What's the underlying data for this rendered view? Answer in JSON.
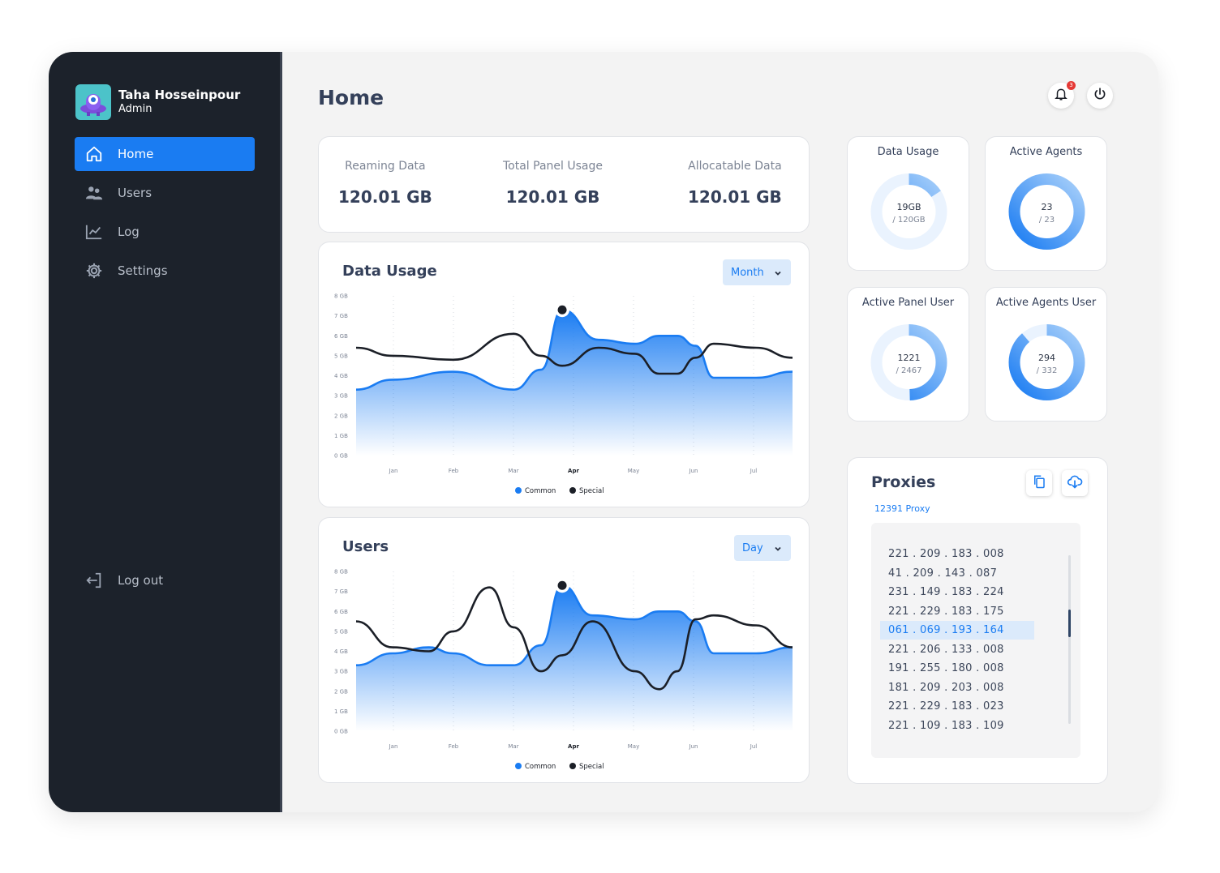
{
  "user": {
    "name": "Taha Hosseinpour",
    "role": "Admin"
  },
  "nav": {
    "items": [
      {
        "label": "Home",
        "icon": "home-icon",
        "active": true
      },
      {
        "label": "Users",
        "icon": "users-icon",
        "active": false
      },
      {
        "label": "Log",
        "icon": "chart-line-icon",
        "active": false
      },
      {
        "label": "Settings",
        "icon": "gear-icon",
        "active": false
      }
    ],
    "logout": {
      "label": "Log out",
      "icon": "logout-icon"
    }
  },
  "header": {
    "title": "Home",
    "notification_count": "3"
  },
  "stats": [
    {
      "label": "Reaming Data",
      "value": "120.01 GB"
    },
    {
      "label": "Total Panel Usage",
      "value": "120.01 GB"
    },
    {
      "label": "Allocatable Data",
      "value": "120.01 GB"
    }
  ],
  "rings": [
    {
      "title": "Data Usage",
      "line1": "19GB",
      "line2": "/ 120GB",
      "fraction": 0.158
    },
    {
      "title": "Active Agents",
      "line1": "23",
      "line2": "/ 23",
      "fraction": 1.0
    },
    {
      "title": "Active Panel User",
      "line1": "1221",
      "line2": "/ 2467",
      "fraction": 0.495
    },
    {
      "title": "Active Agents User",
      "line1": "294",
      "line2": "/ 332",
      "fraction": 0.886
    }
  ],
  "colors": {
    "accent": "#1a7cf2",
    "special": "#1b1f27",
    "sidebar": "#1c222b"
  },
  "chart_data": [
    {
      "type": "area",
      "title": "Data Usage",
      "filter": "Month",
      "categories": [
        "Jan",
        "Feb",
        "Mar",
        "Apr",
        "May",
        "Jun",
        "Jul"
      ],
      "highlight_category": "Apr",
      "y_ticks": [
        "0 GB",
        "1 GB",
        "2 GB",
        "3 GB",
        "4 GB",
        "5 GB",
        "6 GB",
        "7 GB",
        "8 GB"
      ],
      "ylim": [
        0,
        8
      ],
      "x": [
        -0.6,
        0.0,
        1.0,
        2.0,
        2.45,
        2.8,
        3.4,
        4.0,
        4.4,
        4.7,
        5.0,
        5.3,
        6.0,
        6.6
      ],
      "series": [
        {
          "name": "Common",
          "values": [
            3.3,
            3.8,
            4.2,
            3.3,
            4.3,
            7.3,
            5.8,
            5.6,
            6.0,
            6.0,
            5.5,
            3.9,
            3.9,
            4.2
          ]
        },
        {
          "name": "Special",
          "values": [
            5.4,
            5.0,
            4.8,
            6.1,
            5.0,
            4.5,
            5.4,
            5.1,
            4.1,
            4.1,
            4.9,
            5.6,
            5.4,
            4.9
          ]
        }
      ],
      "marker": {
        "x": 2.8,
        "y": 7.3
      },
      "legend": "bottom-center",
      "grid": true
    },
    {
      "type": "area",
      "title": "Users",
      "filter": "Day",
      "categories": [
        "Jan",
        "Feb",
        "Mar",
        "Apr",
        "May",
        "Jun",
        "Jul"
      ],
      "highlight_category": "Apr",
      "y_ticks": [
        "0 GB",
        "1 GB",
        "2 GB",
        "3 GB",
        "4 GB",
        "5 GB",
        "6 GB",
        "7 GB",
        "8 GB"
      ],
      "ylim": [
        0,
        8
      ],
      "x": [
        -0.6,
        0.0,
        0.6,
        1.0,
        1.6,
        2.0,
        2.45,
        2.8,
        3.3,
        4.0,
        4.4,
        4.7,
        5.0,
        5.3,
        6.0,
        6.6
      ],
      "series": [
        {
          "name": "Common",
          "values": [
            3.3,
            3.9,
            4.2,
            3.9,
            3.3,
            3.3,
            4.3,
            7.3,
            5.8,
            5.6,
            6.0,
            6.0,
            5.5,
            3.9,
            3.9,
            4.2
          ]
        },
        {
          "name": "Special",
          "values": [
            5.5,
            4.2,
            4.0,
            5.0,
            7.2,
            5.2,
            3.0,
            3.8,
            5.5,
            3.0,
            2.1,
            3.0,
            5.6,
            5.8,
            5.3,
            4.2
          ]
        }
      ],
      "marker": {
        "x": 2.8,
        "y": 7.3
      },
      "legend": "bottom-center",
      "grid": true
    }
  ],
  "proxies": {
    "title": "Proxies",
    "count_label": "12391 Proxy",
    "selected_index": 4,
    "items": [
      "221 . 209 . 183 . 008",
      "41 . 209 . 143 . 087",
      "231 . 149 . 183 . 224",
      "221 . 229 . 183 . 175",
      "061 . 069 . 193 . 164",
      "221 . 206 . 133 . 008",
      "191 . 255 . 180 . 008",
      "181 . 209 . 203 . 008",
      "221 . 229 . 183 . 023",
      "221 . 109 . 183 . 109"
    ]
  }
}
